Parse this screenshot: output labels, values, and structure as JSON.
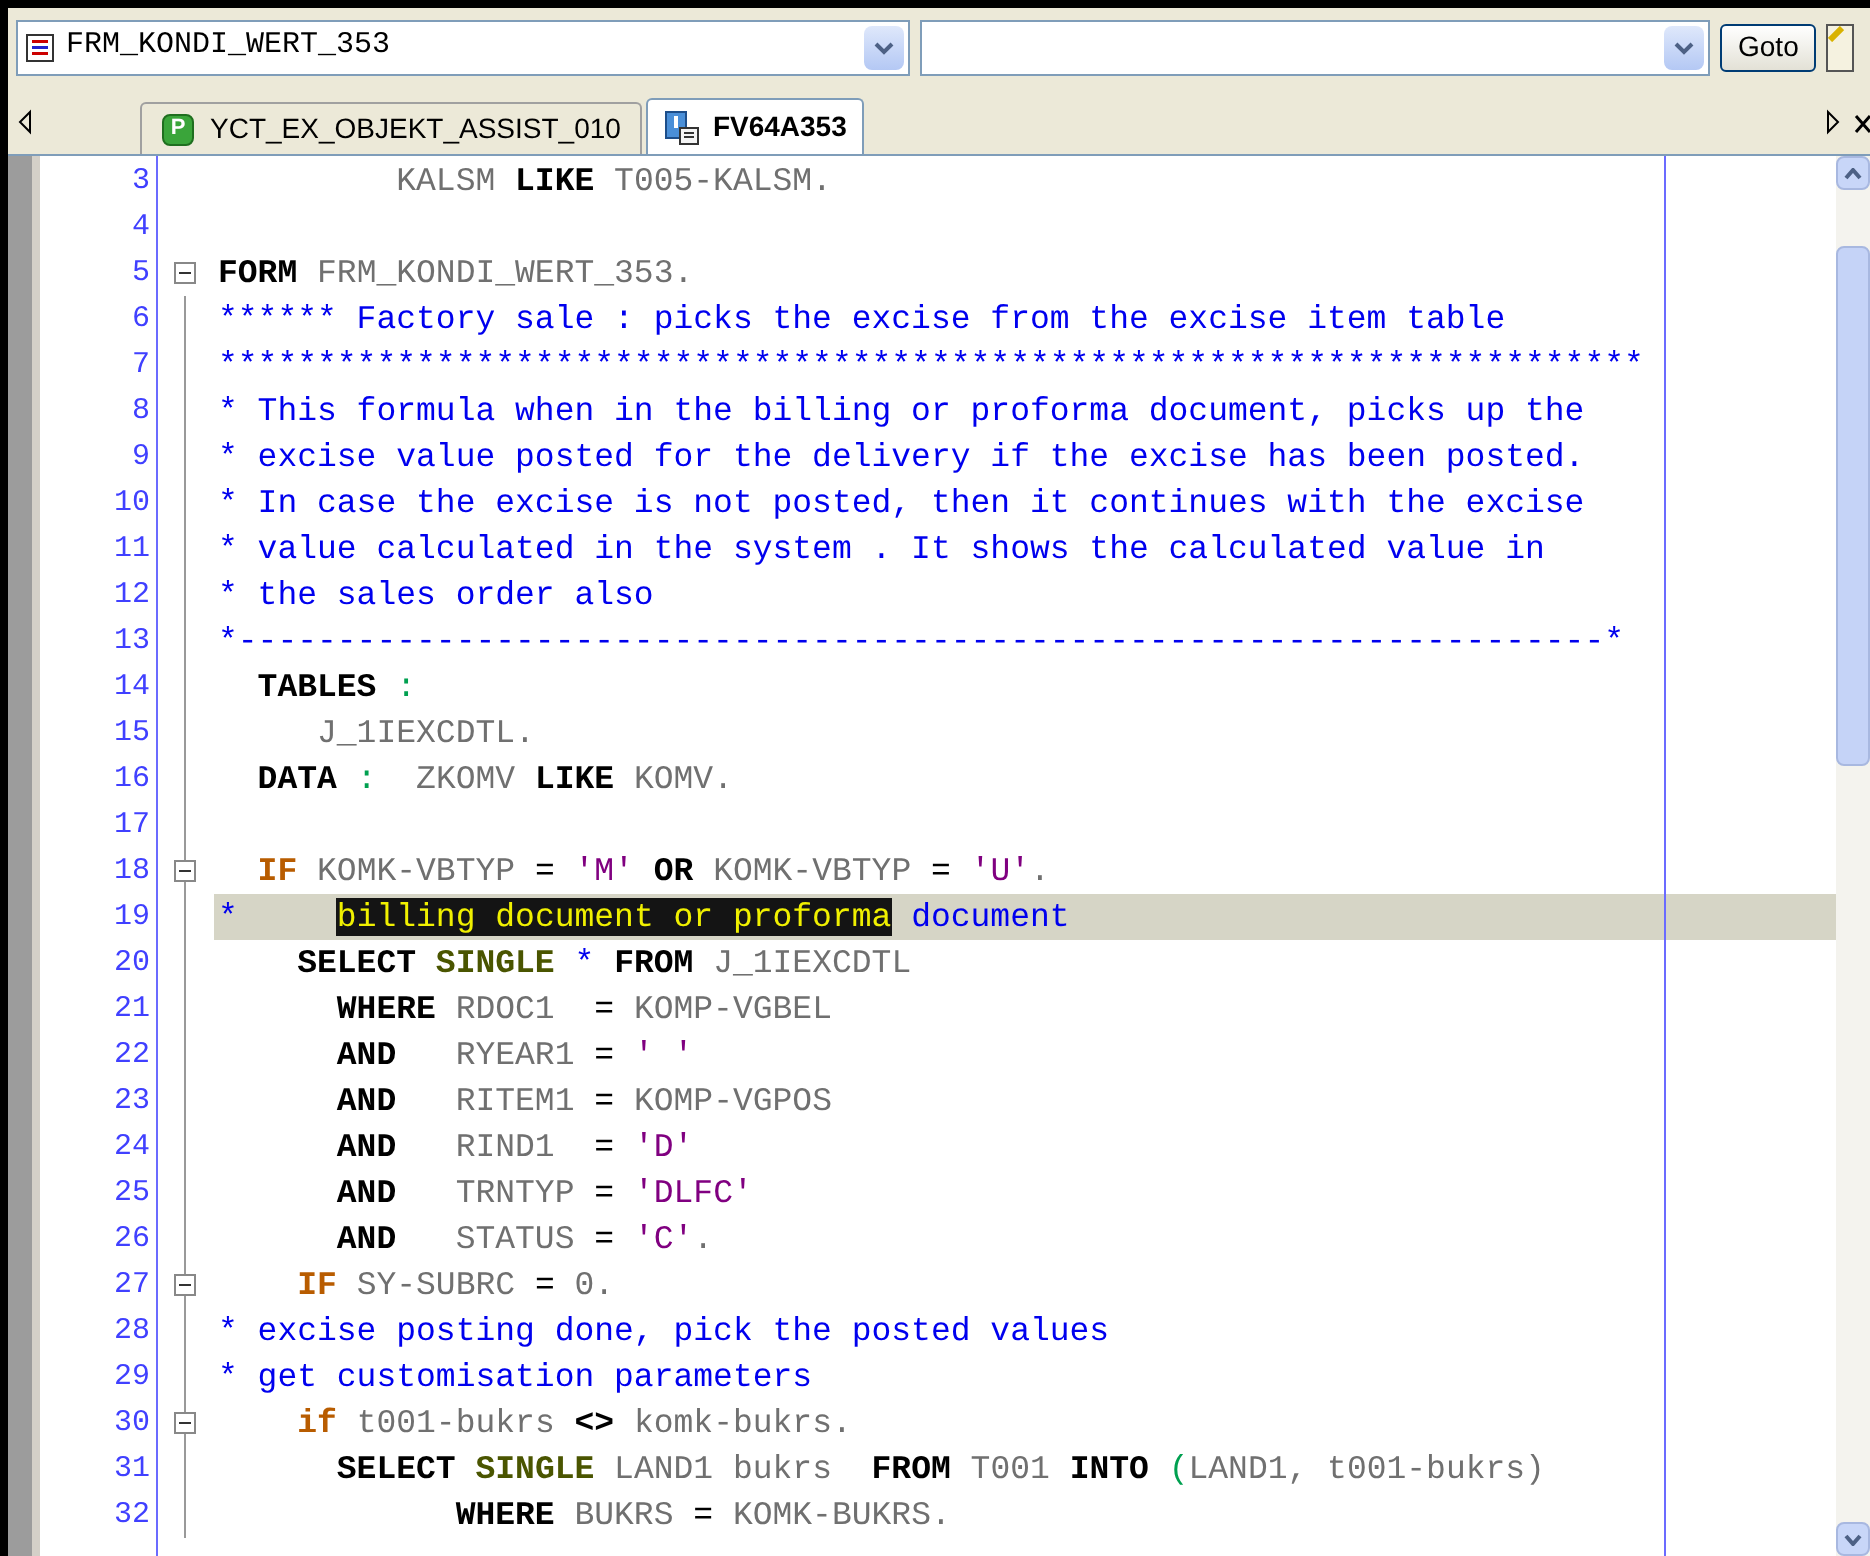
{
  "toolbar": {
    "object_field": {
      "value": "FRM_KONDI_WERT_353"
    },
    "goto_button": "Goto"
  },
  "tabs": [
    {
      "label": "YCT_EX_OBJEKT_ASSIST_010",
      "badge": "P",
      "kind": "program",
      "selected": false
    },
    {
      "label": "FV64A353",
      "kind": "include",
      "selected": true
    }
  ],
  "editor": {
    "lines": [
      {
        "number": "3",
        "current": false,
        "tokens": [
          {
            "kind": "id",
            "text": "         KALSM "
          },
          {
            "kind": "kw",
            "text": "LIKE"
          },
          {
            "kind": "id",
            "text": " T005-KALSM."
          }
        ]
      },
      {
        "number": "4"
      },
      {
        "number": "5",
        "current": false,
        "expanded": true,
        "tokens": [
          {
            "kind": "kw",
            "text": "FORM"
          },
          {
            "kind": "id",
            "text": " FRM_KONDI_WERT_353."
          }
        ]
      },
      {
        "number": "6",
        "current": false,
        "tokens": [
          {
            "kind": "cmt",
            "text": "****** Factory sale : picks the excise from the excise item table"
          }
        ]
      },
      {
        "number": "7",
        "current": false,
        "tokens": [
          {
            "kind": "cmt",
            "text": "************************************************************************"
          }
        ]
      },
      {
        "number": "8",
        "current": false,
        "tokens": [
          {
            "kind": "cmt",
            "text": "* This formula when in the billing or proforma document, picks up the"
          }
        ]
      },
      {
        "number": "9",
        "current": false,
        "tokens": [
          {
            "kind": "cmt",
            "text": "* excise value posted for the delivery if the excise has been posted."
          }
        ]
      },
      {
        "number": "10",
        "current": false,
        "tokens": [
          {
            "kind": "cmt",
            "text": "* In case the excise is not posted, then it continues with the excise"
          }
        ]
      },
      {
        "number": "11",
        "current": false,
        "tokens": [
          {
            "kind": "cmt",
            "text": "* value calculated in the system . It shows the calculated value in"
          }
        ]
      },
      {
        "number": "12",
        "current": false,
        "tokens": [
          {
            "kind": "cmt",
            "text": "* the sales order also"
          }
        ]
      },
      {
        "number": "13",
        "current": false,
        "tokens": [
          {
            "kind": "cmt",
            "text": "*---------------------------------------------------------------------*"
          }
        ]
      },
      {
        "number": "14",
        "current": false,
        "tokens": [
          {
            "kind": "kw",
            "text": "  TABLES"
          },
          {
            "kind": "punct",
            "text": " :"
          }
        ]
      },
      {
        "number": "15",
        "current": false,
        "tokens": [
          {
            "kind": "id",
            "text": "     J_1IEXCDTL."
          }
        ]
      },
      {
        "number": "16",
        "current": false,
        "tokens": [
          {
            "kind": "kw",
            "text": "  DATA"
          },
          {
            "kind": "punct",
            "text": " :"
          },
          {
            "kind": "id",
            "text": "  ZKOMV "
          },
          {
            "kind": "kw",
            "text": "LIKE"
          },
          {
            "kind": "id",
            "text": " KOMV."
          }
        ]
      },
      {
        "number": "17"
      },
      {
        "number": "18",
        "current": false,
        "expanded": true,
        "tokens": [
          {
            "kind": "ctrl",
            "text": "  IF"
          },
          {
            "kind": "id",
            "text": " KOMK-VBTYP "
          },
          {
            "kind": "op",
            "text": "="
          },
          {
            "kind": "str",
            "text": " 'M' "
          },
          {
            "kind": "kw",
            "text": "OR"
          },
          {
            "kind": "id",
            "text": " KOMK-VBTYP "
          },
          {
            "kind": "op",
            "text": "="
          },
          {
            "kind": "str",
            "text": " 'U'"
          },
          {
            "kind": "id",
            "text": "."
          }
        ]
      },
      {
        "number": "19",
        "current": true,
        "tokens": [
          {
            "kind": "cmt",
            "text": "*     "
          },
          {
            "kind": "sel",
            "text": "billing document or proforma"
          },
          {
            "kind": "cmt",
            "text": " document"
          }
        ]
      },
      {
        "number": "20",
        "current": false,
        "tokens": [
          {
            "kind": "kw",
            "text": "    SELECT "
          },
          {
            "kind": "single",
            "text": "SINGLE"
          },
          {
            "kind": "cmt",
            "text": " * "
          },
          {
            "kind": "kw",
            "text": "FROM"
          },
          {
            "kind": "id",
            "text": " J_1IEXCDTL"
          }
        ]
      },
      {
        "number": "21",
        "current": false,
        "tokens": [
          {
            "kind": "kw",
            "text": "      WHERE"
          },
          {
            "kind": "id",
            "text": " RDOC1  "
          },
          {
            "kind": "op",
            "text": "="
          },
          {
            "kind": "id",
            "text": " KOMP-VGBEL"
          }
        ]
      },
      {
        "number": "22",
        "current": false,
        "tokens": [
          {
            "kind": "kw",
            "text": "      AND"
          },
          {
            "kind": "id",
            "text": "   RYEAR1 "
          },
          {
            "kind": "op",
            "text": "="
          },
          {
            "kind": "str",
            "text": " ' '"
          }
        ]
      },
      {
        "number": "23",
        "current": false,
        "tokens": [
          {
            "kind": "kw",
            "text": "      AND"
          },
          {
            "kind": "id",
            "text": "   RITEM1 "
          },
          {
            "kind": "op",
            "text": "="
          },
          {
            "kind": "id",
            "text": " KOMP-VGPOS"
          }
        ]
      },
      {
        "number": "24",
        "current": false,
        "tokens": [
          {
            "kind": "kw",
            "text": "      AND"
          },
          {
            "kind": "id",
            "text": "   RIND1  "
          },
          {
            "kind": "op",
            "text": "="
          },
          {
            "kind": "str",
            "text": " 'D'"
          }
        ]
      },
      {
        "number": "25",
        "current": false,
        "tokens": [
          {
            "kind": "kw",
            "text": "      AND"
          },
          {
            "kind": "id",
            "text": "   TRNTYP "
          },
          {
            "kind": "op",
            "text": "="
          },
          {
            "kind": "str",
            "text": " 'DLFC'"
          }
        ]
      },
      {
        "number": "26",
        "current": false,
        "tokens": [
          {
            "kind": "kw",
            "text": "      AND"
          },
          {
            "kind": "id",
            "text": "   STATUS "
          },
          {
            "kind": "op",
            "text": "="
          },
          {
            "kind": "str",
            "text": " 'C'"
          },
          {
            "kind": "id",
            "text": "."
          }
        ]
      },
      {
        "number": "27",
        "current": false,
        "expanded": true,
        "tokens": [
          {
            "kind": "ctrl",
            "text": "    IF"
          },
          {
            "kind": "id",
            "text": " SY-SUBRC "
          },
          {
            "kind": "op",
            "text": "="
          },
          {
            "kind": "id",
            "text": " 0."
          }
        ]
      },
      {
        "number": "28",
        "current": false,
        "tokens": [
          {
            "kind": "cmt",
            "text": "* excise posting done, pick the posted values"
          }
        ]
      },
      {
        "number": "29",
        "current": false,
        "tokens": [
          {
            "kind": "cmt",
            "text": "* get customisation parameters"
          }
        ]
      },
      {
        "number": "30",
        "current": false,
        "expanded": true,
        "tokens": [
          {
            "kind": "ctrl",
            "text": "    if"
          },
          {
            "kind": "id",
            "text": " t001-bukrs "
          },
          {
            "kind": "kw",
            "text": "<>"
          },
          {
            "kind": "id",
            "text": " komk-bukrs."
          }
        ]
      },
      {
        "number": "31",
        "current": false,
        "tokens": [
          {
            "kind": "kw",
            "text": "      SELECT "
          },
          {
            "kind": "single",
            "text": "SINGLE"
          },
          {
            "kind": "id",
            "text": " LAND1 bukrs  "
          },
          {
            "kind": "kw",
            "text": "FROM"
          },
          {
            "kind": "id",
            "text": " T001 "
          },
          {
            "kind": "kw",
            "text": "INTO"
          },
          {
            "kind": "punct",
            "text": " ("
          },
          {
            "kind": "id",
            "text": "LAND1, t001-bukrs)"
          }
        ]
      },
      {
        "number": "32",
        "current": false,
        "tokens": [
          {
            "kind": "kw",
            "text": "            WHERE"
          },
          {
            "kind": "id",
            "text": " BUKRS "
          },
          {
            "kind": "op",
            "text": "="
          },
          {
            "kind": "id",
            "text": " KOMK-BUKRS."
          }
        ]
      }
    ]
  }
}
